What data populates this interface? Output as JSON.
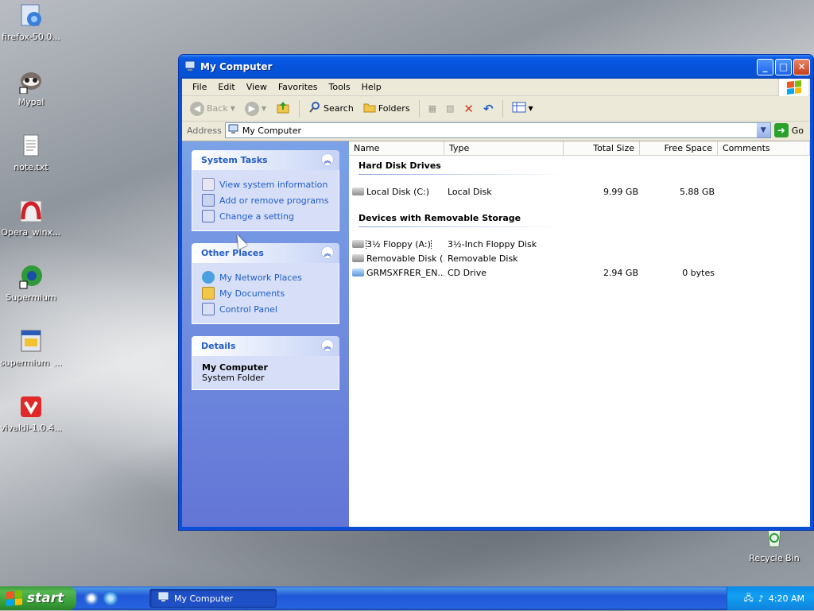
{
  "desktop": {
    "icons": [
      {
        "label": "firefox-50.0...",
        "icon": "installer-icon"
      },
      {
        "label": "Mypal",
        "icon": "mypal-icon"
      },
      {
        "label": "note.txt",
        "icon": "text-file-icon"
      },
      {
        "label": "Opera_winx...",
        "icon": "opera-installer-icon"
      },
      {
        "label": "Supermium",
        "icon": "supermium-icon"
      },
      {
        "label": "supermium_...",
        "icon": "installer-icon"
      },
      {
        "label": "vivaldi-1.0.4...",
        "icon": "vivaldi-icon"
      },
      {
        "label": "Recycle Bin",
        "icon": "recycle-bin-icon"
      }
    ]
  },
  "window": {
    "title": "My Computer",
    "menu": [
      "File",
      "Edit",
      "View",
      "Favorites",
      "Tools",
      "Help"
    ],
    "toolbar": {
      "back": "Back",
      "search": "Search",
      "folders": "Folders"
    },
    "address": {
      "label": "Address",
      "value": "My Computer",
      "go": "Go"
    },
    "left_panels": {
      "system_tasks": {
        "title": "System Tasks",
        "links": [
          "View system information",
          "Add or remove programs",
          "Change a setting"
        ]
      },
      "other_places": {
        "title": "Other Places",
        "links": [
          "My Network Places",
          "My Documents",
          "Control Panel"
        ]
      },
      "details": {
        "title": "Details",
        "name": "My Computer",
        "type": "System Folder"
      }
    },
    "columns": [
      "Name",
      "Type",
      "Total Size",
      "Free Space",
      "Comments"
    ],
    "groups": [
      {
        "title": "Hard Disk Drives",
        "items": [
          {
            "name": "Local Disk (C:)",
            "type": "Local Disk",
            "total": "9.99 GB",
            "free": "5.88 GB"
          }
        ]
      },
      {
        "title": "Devices with Removable Storage",
        "items": [
          {
            "name": "3½ Floppy (A:)",
            "type": "3½-Inch Floppy Disk",
            "total": "",
            "free": ""
          },
          {
            "name": "Removable Disk (...",
            "type": "Removable Disk",
            "total": "",
            "free": ""
          },
          {
            "name": "GRMSXFRER_EN...",
            "type": "CD Drive",
            "total": "2.94 GB",
            "free": "0 bytes"
          }
        ]
      }
    ]
  },
  "taskbar": {
    "start": "start",
    "task": "My Computer",
    "clock": "4:20 AM"
  },
  "colors": {
    "title_blue": "#0754db",
    "taskbar_blue": "#2157d7",
    "start_green": "#379e37",
    "link_blue": "#215dc6"
  }
}
